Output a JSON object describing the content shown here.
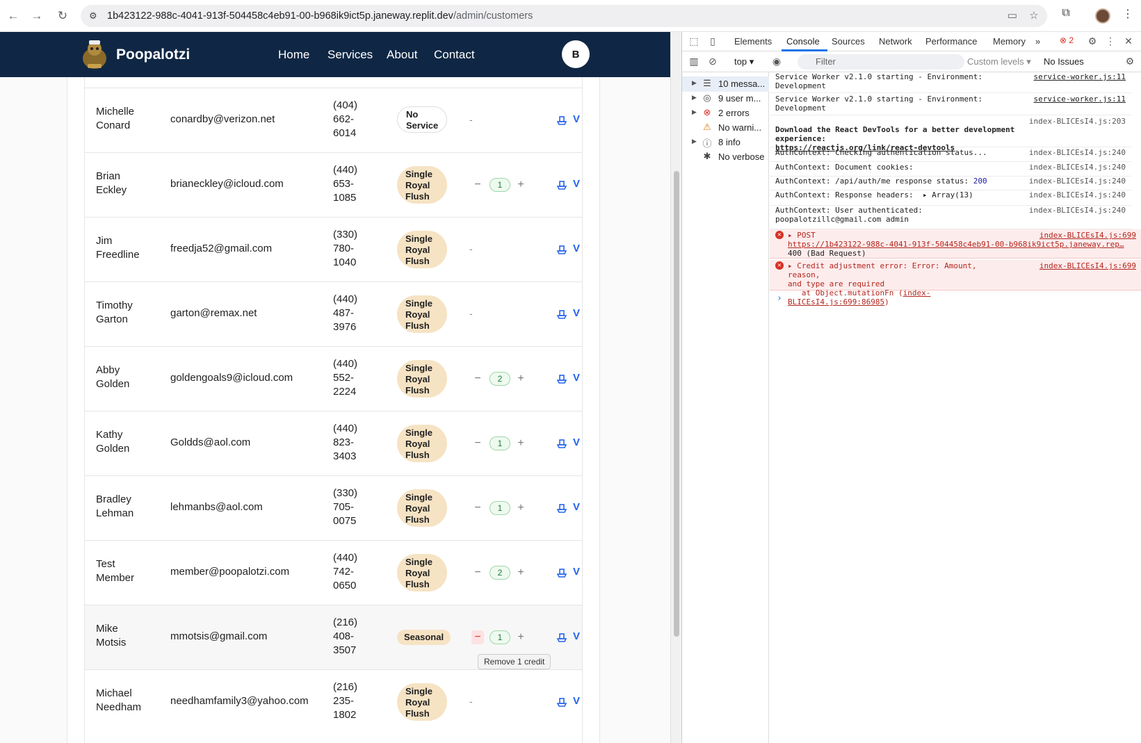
{
  "browser": {
    "url_host": "1b423122-988c-4041-913f-504458c4eb91-00-b968ik9ict5p.janeway.replit.dev",
    "url_path": "/admin/customers"
  },
  "site": {
    "brand": "Poopalotzi",
    "nav": [
      "Home",
      "Services",
      "About",
      "Contact"
    ],
    "user_initial": "B"
  },
  "customers": [
    {
      "first": "Michelle",
      "last": "Conard",
      "email": "conardby@verizon.net",
      "phone": [
        "(404)",
        "662-",
        "6014"
      ],
      "service": [
        "No",
        "Service"
      ],
      "credits": null
    },
    {
      "first": "Brian",
      "last": "Eckley",
      "email": "brianeckley@icloud.com",
      "phone": [
        "(440)",
        "653-",
        "1085"
      ],
      "service": [
        "Single",
        "Royal",
        "Flush"
      ],
      "credits": "1"
    },
    {
      "first": "Jim",
      "last": "Freedline",
      "email": "freedja52@gmail.com",
      "phone": [
        "(330)",
        "780-",
        "1040"
      ],
      "service": [
        "Single",
        "Royal",
        "Flush"
      ],
      "credits": null
    },
    {
      "first": "Timothy",
      "last": "Garton",
      "email": "garton@remax.net",
      "phone": [
        "(440)",
        "487-",
        "3976"
      ],
      "service": [
        "Single",
        "Royal",
        "Flush"
      ],
      "credits": null
    },
    {
      "first": "Abby",
      "last": "Golden",
      "email": "goldengoals9@icloud.com",
      "phone": [
        "(440)",
        "552-",
        "2224"
      ],
      "service": [
        "Single",
        "Royal",
        "Flush"
      ],
      "credits": "2"
    },
    {
      "first": "Kathy",
      "last": "Golden",
      "email": "Goldds@aol.com",
      "phone": [
        "(440)",
        "823-",
        "3403"
      ],
      "service": [
        "Single",
        "Royal",
        "Flush"
      ],
      "credits": "1"
    },
    {
      "first": "Bradley",
      "last": "Lehman",
      "email": "lehmanbs@aol.com",
      "phone": [
        "(330)",
        "705-",
        "0075"
      ],
      "service": [
        "Single",
        "Royal",
        "Flush"
      ],
      "credits": "1"
    },
    {
      "first": "Test",
      "last": "Member",
      "email": "member@poopalotzi.com",
      "phone": [
        "(440)",
        "742-",
        "0650"
      ],
      "service": [
        "Single",
        "Royal",
        "Flush"
      ],
      "credits": "2"
    },
    {
      "first": "Mike",
      "last": "Motsis",
      "email": "mmotsis@gmail.com",
      "phone": [
        "(216)",
        "408-",
        "3507"
      ],
      "service": [
        "Seasonal"
      ],
      "credits": "1"
    },
    {
      "first": "Michael",
      "last": "Needham",
      "email": "needhamfamily3@yahoo.com",
      "phone": [
        "(216)",
        "235-",
        "1802"
      ],
      "service": [
        "Single",
        "Royal",
        "Flush"
      ],
      "credits": null
    }
  ],
  "credit_labels": {
    "minus": "−",
    "plus": "+",
    "none": "-",
    "view": "V"
  },
  "tooltip": "Remove 1 credit",
  "devtools": {
    "tabs": [
      "Elements",
      "Console",
      "Sources",
      "Network",
      "Performance",
      "Memory"
    ],
    "more": "»",
    "error_count": "2",
    "context": "top",
    "filter_placeholder": "Filter",
    "levels": "Custom levels",
    "issues": "No Issues",
    "sidebar": [
      {
        "icon": "list-icon",
        "label": "10 messa..."
      },
      {
        "icon": "user-icon",
        "label": "9 user m..."
      },
      {
        "icon": "error-icon",
        "label": "2 errors"
      },
      {
        "icon": "warning-icon",
        "label": "No warni..."
      },
      {
        "icon": "info-icon",
        "label": "8 info"
      },
      {
        "icon": "bug-icon",
        "label": "No verbose"
      }
    ],
    "logs": [
      {
        "msg": "Service Worker v2.1.0 starting - Environment: Development",
        "src": "service-worker.js:11"
      },
      {
        "msg": "Service Worker v2.1.0 starting - Environment: Development",
        "src": "service-worker.js:11"
      },
      {
        "msg": "Download the React DevTools for a better development experience:",
        "link": "https://reactjs.org/link/react-devtools",
        "src": "index-BLICEsI4.js:203"
      },
      {
        "msg": "AuthContext: Checking authentication status...",
        "src": "index-BLICEsI4.js:240"
      },
      {
        "msg": "AuthContext: Document cookies:",
        "src": "index-BLICEsI4.js:240"
      },
      {
        "msg": "AuthContext: /api/auth/me response status:",
        "status": "200",
        "src": "index-BLICEsI4.js:240"
      },
      {
        "msg": "AuthContext: Response headers:",
        "extra": "▸ Array(13)",
        "src": "index-BLICEsI4.js:240"
      },
      {
        "msg": "AuthContext: User authenticated:",
        "line2": "poopalotzillc@gmail.com admin",
        "src": "index-BLICEsI4.js:240"
      }
    ],
    "errors": [
      {
        "head": "▸ POST",
        "url": "https://1b423122-988c-4041-913f-504458c4eb91-00-b968ik9ict5p.janeway.rep…",
        "line3": "400 (Bad Request)",
        "src": "index-BLICEsI4.js:699"
      },
      {
        "head": "▸ Credit adjustment error: Error: Amount, reason,",
        "line2": "and type are required",
        "line3": "at Object.mutationFn (",
        "link": "index-BLICEsI4.js:699:86985",
        "line3end": ")",
        "src": "index-BLICEsI4.js:699"
      }
    ],
    "prompt": "›"
  }
}
